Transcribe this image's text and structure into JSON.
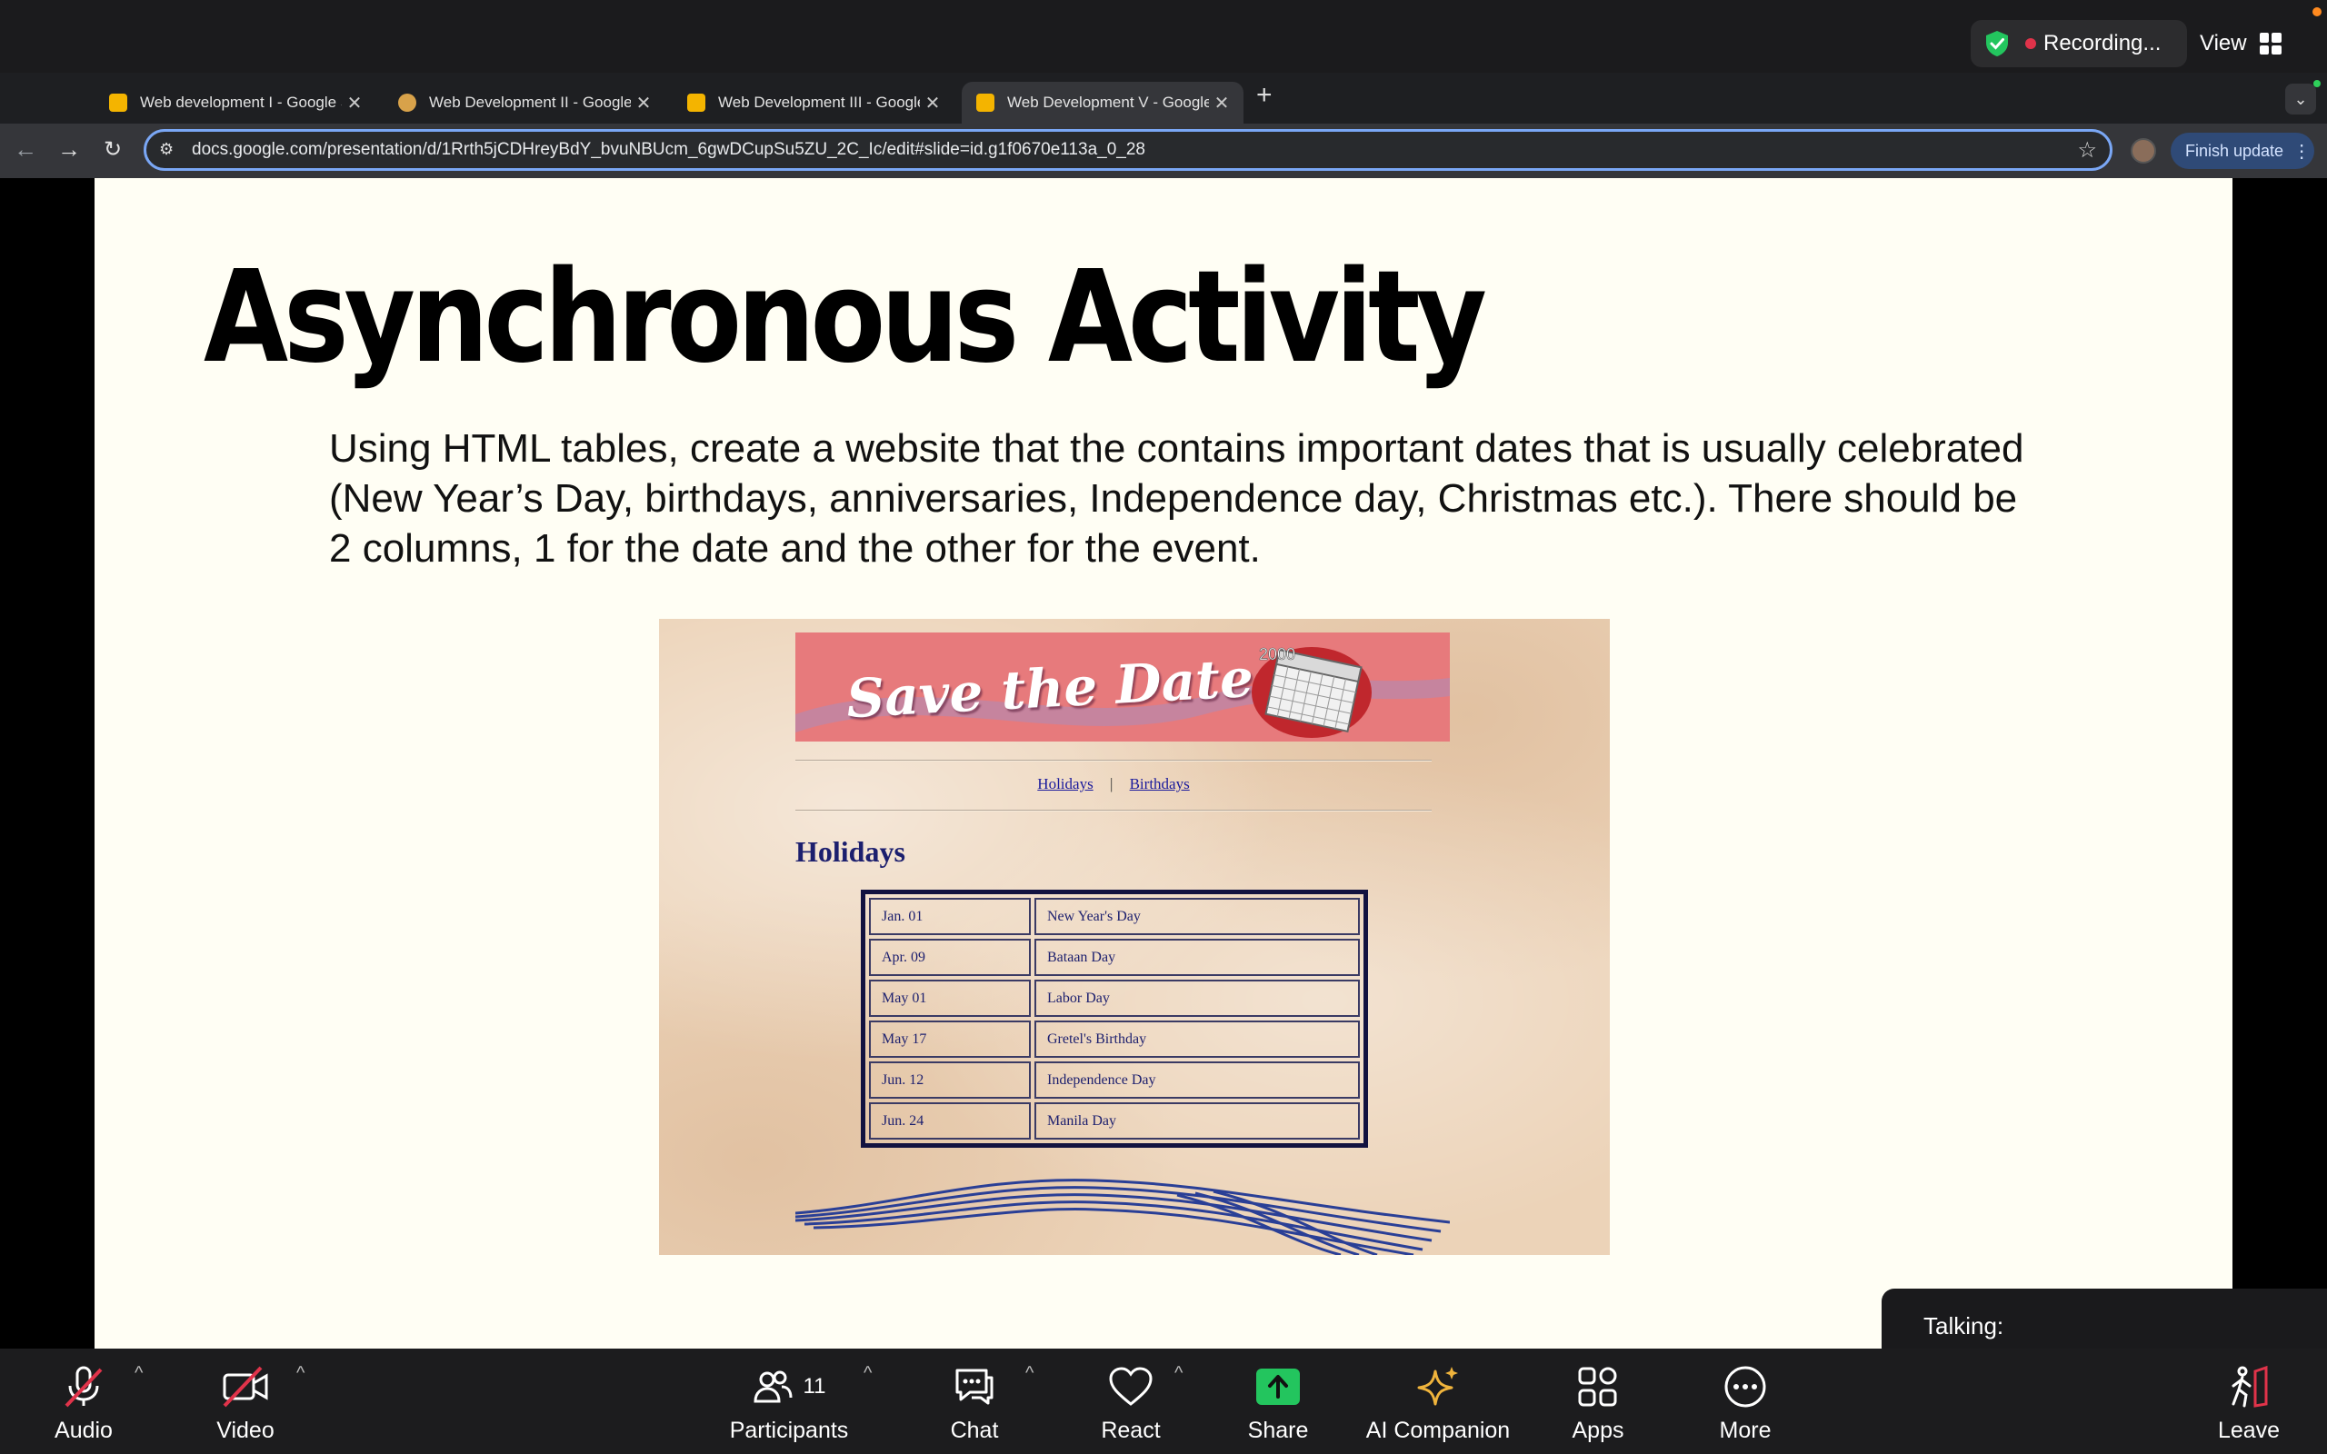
{
  "zoom_top": {
    "recording_label": "Recording...",
    "view_label": "View"
  },
  "tabs": [
    {
      "label": "Web development I - Google Slides",
      "active": false
    },
    {
      "label": "Web Development II - Google Slides",
      "active": false
    },
    {
      "label": "Web Development III - Google Slides",
      "active": false
    },
    {
      "label": "Web Development V - Google Slides",
      "active": true
    }
  ],
  "browser": {
    "url": "docs.google.com/presentation/d/1Rrth5jCDHreyBdY_bvuNBUcm_6gwDCupSu5ZU_2C_Ic/edit#slide=id.g1f0670e113a_0_28",
    "finish_update_label": "Finish update"
  },
  "slide": {
    "title": "Asynchronous Activity",
    "body": "Using HTML tables, create a website that the contains important dates that is usually celebrated (New Year’s Day, birthdays, anniversaries, Independence day, Christmas etc.). There should be 2 columns, 1 for the date and the other for the event."
  },
  "example_site": {
    "banner_text": "Save the Dates!",
    "calendar_year": "2000",
    "nav": [
      "Holidays",
      "Birthdays"
    ],
    "nav_separator": "|",
    "heading": "Holidays",
    "rows": [
      {
        "date": "Jan. 01",
        "event": "New Year's Day"
      },
      {
        "date": "Apr. 09",
        "event": "Bataan Day"
      },
      {
        "date": "May 01",
        "event": "Labor Day"
      },
      {
        "date": "May 17",
        "event": "Gretel's Birthday"
      },
      {
        "date": "Jun. 12",
        "event": "Independence Day"
      },
      {
        "date": "Jun. 24",
        "event": "Manila Day"
      }
    ]
  },
  "talking": {
    "label": "Talking:"
  },
  "zoom_bottom": {
    "audio": "Audio",
    "video": "Video",
    "participants": "Participants",
    "participants_count": "11",
    "chat": "Chat",
    "react": "React",
    "share": "Share",
    "ai_companion": "AI Companion",
    "apps": "Apps",
    "more": "More",
    "leave": "Leave"
  },
  "colors": {
    "share_green": "#23c55e",
    "leave_red": "#e0334a",
    "ai_gold": "#f0b43c",
    "omnibox_focus": "#7aa7f5"
  }
}
